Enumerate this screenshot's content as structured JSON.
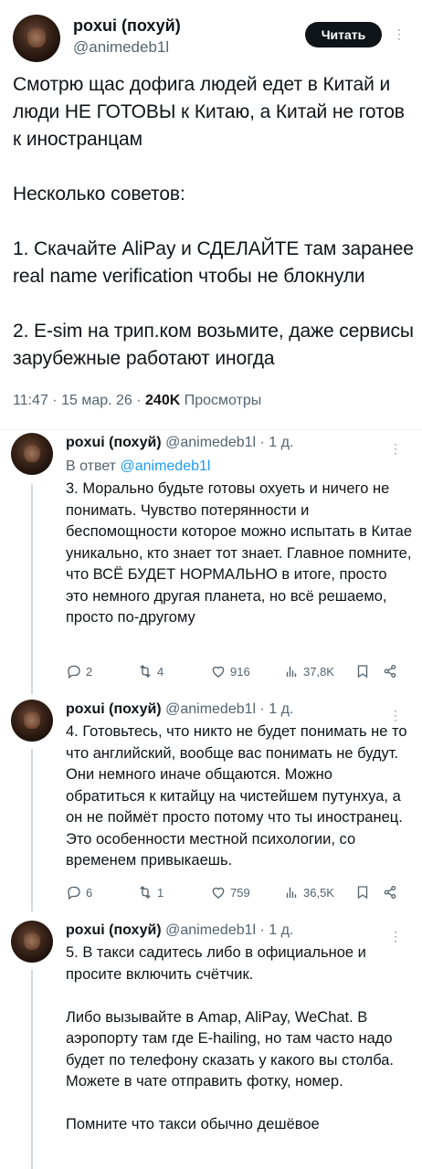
{
  "main": {
    "name": "poxui (похуй)",
    "handle": "@animedeb1l",
    "follow_label": "Читать",
    "text": "Смотрю щас дофига людей едет в Китай и люди НЕ ГОТОВЫ к Китаю, а Китай не готов к иностранцам\n\nНесколько советов:\n\n1. Скачайте AliPay и СДЕЛАЙТЕ там заранее real name verification чтобы не блокнули\n\n2. E-sim на трип.ком возьмите, даже сервисы зарубежные работают иногда",
    "time": "11:47 · 15 мар. 26 ·",
    "views_count": "240K",
    "views_label": "Просмотры"
  },
  "replies": [
    {
      "name": "poxui (похуй)",
      "handle_time": "@animedeb1l · 1 д.",
      "reply_to_prefix": "В ответ",
      "reply_to_handle": "@animedeb1l",
      "text": "3. Морально будьте готовы охуеть и ничего не понимать. Чувство потерянности и беспомощности которое можно испытать в Китае уникально, кто знает тот знает. Главное помните, что ВСЁ БУДЕТ НОРМАЛЬНО в итоге, просто это немного другая планета, но всё решаемо, просто по-другому",
      "replies": "2",
      "retweets": "4",
      "likes": "916",
      "views": "37,8K"
    },
    {
      "name": "poxui (похуй)",
      "handle_time": "@animedeb1l · 1 д.",
      "text": "4. Готовьтесь, что никто не будет понимать не то что английский, вообще вас понимать не будут. Они немного иначе общаются. Можно обратиться к китайцу на чистейшем путунхуа, а он не поймёт просто потому что ты иностранец. Это особенности местной психологии, со временем привыкаешь.",
      "replies": "6",
      "retweets": "1",
      "likes": "759",
      "views": "36,5K"
    },
    {
      "name": "poxui (похуй)",
      "handle_time": "@animedeb1l · 1 д.",
      "text": "5. В такси садитесь либо в официальное и просите включить счётчик.\n\nЛибо вызывайте в Amap, AliPay, WeChat. В аэропорту там где E-hailing, но там часто надо будет по телефону сказать у какого вы столба. Можете в чате отправить фотку, номер.\n\nПомните что такси обычно дешёвое"
    }
  ],
  "icons": [
    "reply-icon",
    "retweet-icon",
    "like-icon",
    "views-icon",
    "bookmark-icon",
    "share-icon",
    "more-icon"
  ]
}
